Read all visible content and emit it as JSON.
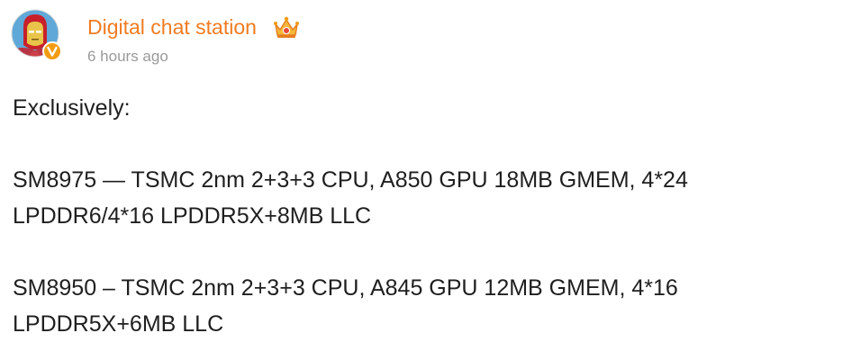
{
  "post": {
    "author": "Digital chat station",
    "time": "6 hours ago",
    "avatar_icon": "iron-man-avatar-icon",
    "verified_icon": "verified-v-badge-icon",
    "crown_icon": "crown-badge-icon",
    "accent_color": "#f07c22",
    "body": {
      "intro": "Exclusively:",
      "line1": "SM8975 — TSMC 2nm 2+3+3 CPU, A850 GPU 18MB GMEM, 4*24",
      "line2": "LPDDR6/4*16 LPDDR5X+8MB LLC",
      "line3": "SM8950 – TSMC 2nm 2+3+3 CPU, A845 GPU 12MB GMEM, 4*16",
      "line4": "LPDDR5X+6MB LLC"
    }
  }
}
